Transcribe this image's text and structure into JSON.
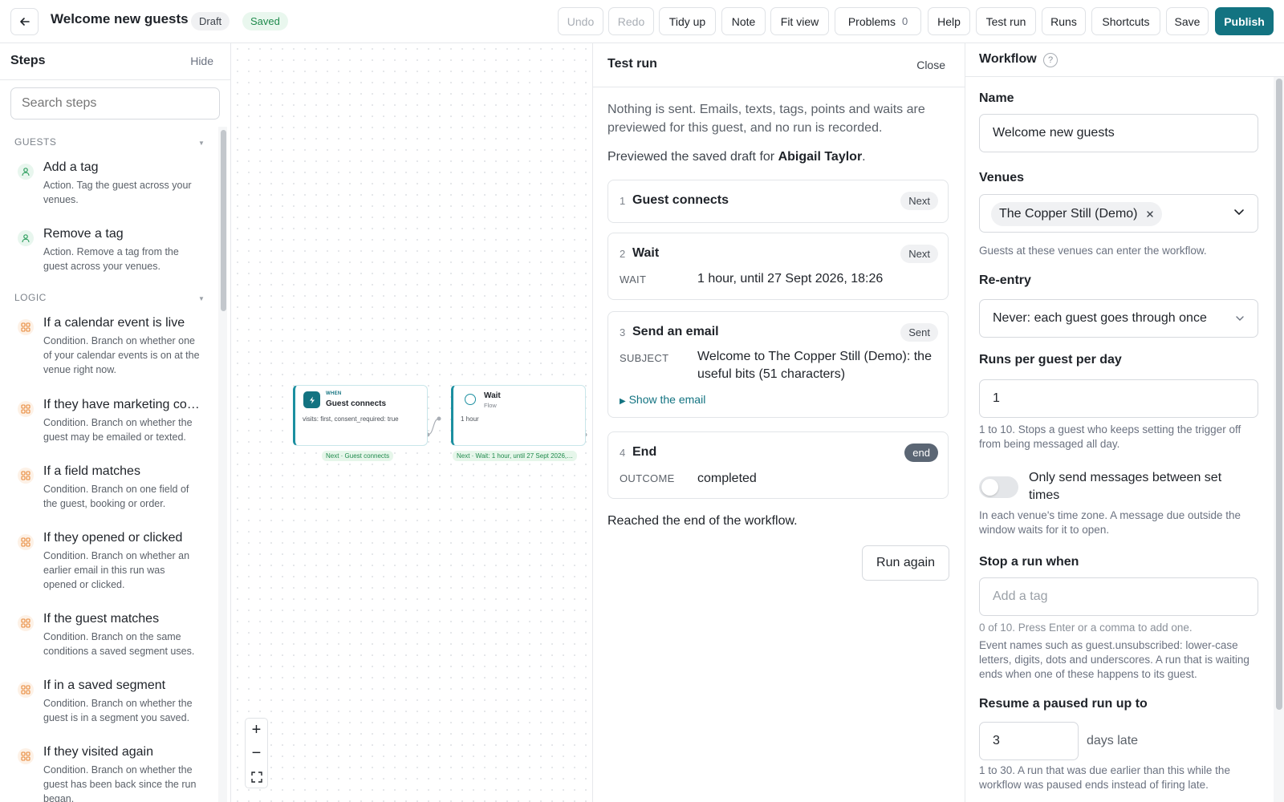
{
  "topbar": {
    "title": "Welcome new guests",
    "draft_label": "Draft",
    "saved_label": "Saved",
    "undo": "Undo",
    "redo": "Redo",
    "tidy_up": "Tidy up",
    "note": "Note",
    "fit_view": "Fit view",
    "problems": "Problems",
    "problems_count": "0",
    "help": "Help",
    "test_run": "Test run",
    "runs": "Runs",
    "shortcuts": "Shortcuts",
    "save": "Save",
    "publish": "Publish"
  },
  "steps": {
    "title": "Steps",
    "hide": "Hide",
    "search_placeholder": "Search steps",
    "sections": [
      {
        "label": "GUESTS",
        "items": [
          {
            "name": "Add a tag",
            "desc": "Action. Tag the guest across your venues.",
            "icon": "person-icon"
          },
          {
            "name": "Remove a tag",
            "desc": "Action. Remove a tag from the guest across your venues.",
            "icon": "person-icon"
          }
        ]
      },
      {
        "label": "LOGIC",
        "items": [
          {
            "name": "If a calendar event is live",
            "desc": "Condition. Branch on whether one of your calendar events is on at the venue right now.",
            "icon": "grid-icon"
          },
          {
            "name": "If they have marketing co…",
            "desc": "Condition. Branch on whether the guest may be emailed or texted.",
            "icon": "grid-icon"
          },
          {
            "name": "If a field matches",
            "desc": "Condition. Branch on one field of the guest, booking or order.",
            "icon": "grid-icon"
          },
          {
            "name": "If they opened or clicked",
            "desc": "Condition. Branch on whether an earlier email in this run was opened or clicked.",
            "icon": "grid-icon"
          },
          {
            "name": "If the guest matches",
            "desc": "Condition. Branch on the same conditions a saved segment uses.",
            "icon": "grid-icon"
          },
          {
            "name": "If in a saved segment",
            "desc": "Condition. Branch on whether the guest is in a segment you saved.",
            "icon": "grid-icon"
          },
          {
            "name": "If they visited again",
            "desc": "Condition. Branch on whether the guest has been back since the run began.",
            "icon": "grid-icon"
          }
        ]
      }
    ]
  },
  "canvas": {
    "node1": {
      "kicker": "WHEN",
      "title": "Guest connects",
      "body": "visits: first, consent_required: true",
      "tag": "Next · Guest connects"
    },
    "node2": {
      "title": "Wait",
      "sub": "Flow",
      "body": "1 hour",
      "tag": "Next · Wait: 1 hour, until 27 Sept 2026,…"
    },
    "zoom_in": "+",
    "zoom_out": "−"
  },
  "test_run": {
    "title": "Test run",
    "close": "Close",
    "intro": "Nothing is sent. Emails, texts, tags, points and waits are previewed for this guest, and no run is recorded.",
    "preview_prefix": "Previewed the saved draft for ",
    "preview_guest": "Abigail Taylor",
    "preview_suffix": ".",
    "cards": [
      {
        "num": "1",
        "title": "Guest connects",
        "status": "Next"
      },
      {
        "num": "2",
        "title": "Wait",
        "status": "Next",
        "key": "WAIT",
        "value": "1 hour, until 27 Sept 2026, 18:26"
      },
      {
        "num": "3",
        "title": "Send an email",
        "status": "Sent",
        "key": "SUBJECT",
        "value": "Welcome to The Copper Still (Demo): the useful bits (51 characters)",
        "link": "Show the email"
      },
      {
        "num": "4",
        "title": "End",
        "status": "end",
        "key": "OUTCOME",
        "value": "completed"
      }
    ],
    "end_message": "Reached the end of the workflow.",
    "run_again": "Run again"
  },
  "workflow": {
    "title": "Workflow",
    "help": "?",
    "name_label": "Name",
    "name_value": "Welcome new guests",
    "venues_label": "Venues",
    "venue_chip": "The Copper Still (Demo)",
    "venues_help": "Guests at these venues can enter the workflow.",
    "reentry_label": "Re-entry",
    "reentry_value": "Never: each guest goes through once",
    "runs_label": "Runs per guest per day",
    "runs_value": "1",
    "runs_help": "1 to 10. Stops a guest who keeps setting the trigger off from being messaged all day.",
    "toggle_label": "Only send messages between set times",
    "toggle_on": false,
    "toggle_help": "In each venue's time zone. A message due outside the window waits for it to open.",
    "stop_label": "Stop a run when",
    "stop_placeholder": "Add a tag",
    "stop_help1": "0 of 10. Press Enter or a comma to add one.",
    "stop_help2": "Event names such as guest.unsubscribed: lower-case letters, digits, dots and underscores. A run that is waiting ends when one of these happens to its guest.",
    "resume_label": "Resume a paused run up to",
    "resume_value": "3",
    "resume_suffix": "days late",
    "resume_help": "1 to 30. A run that was due earlier than this while the workflow was paused ends instead of firing late."
  },
  "colors": {
    "accent": "#137381",
    "success": "#1f8a4c",
    "condition_icon": "#e8893a"
  }
}
